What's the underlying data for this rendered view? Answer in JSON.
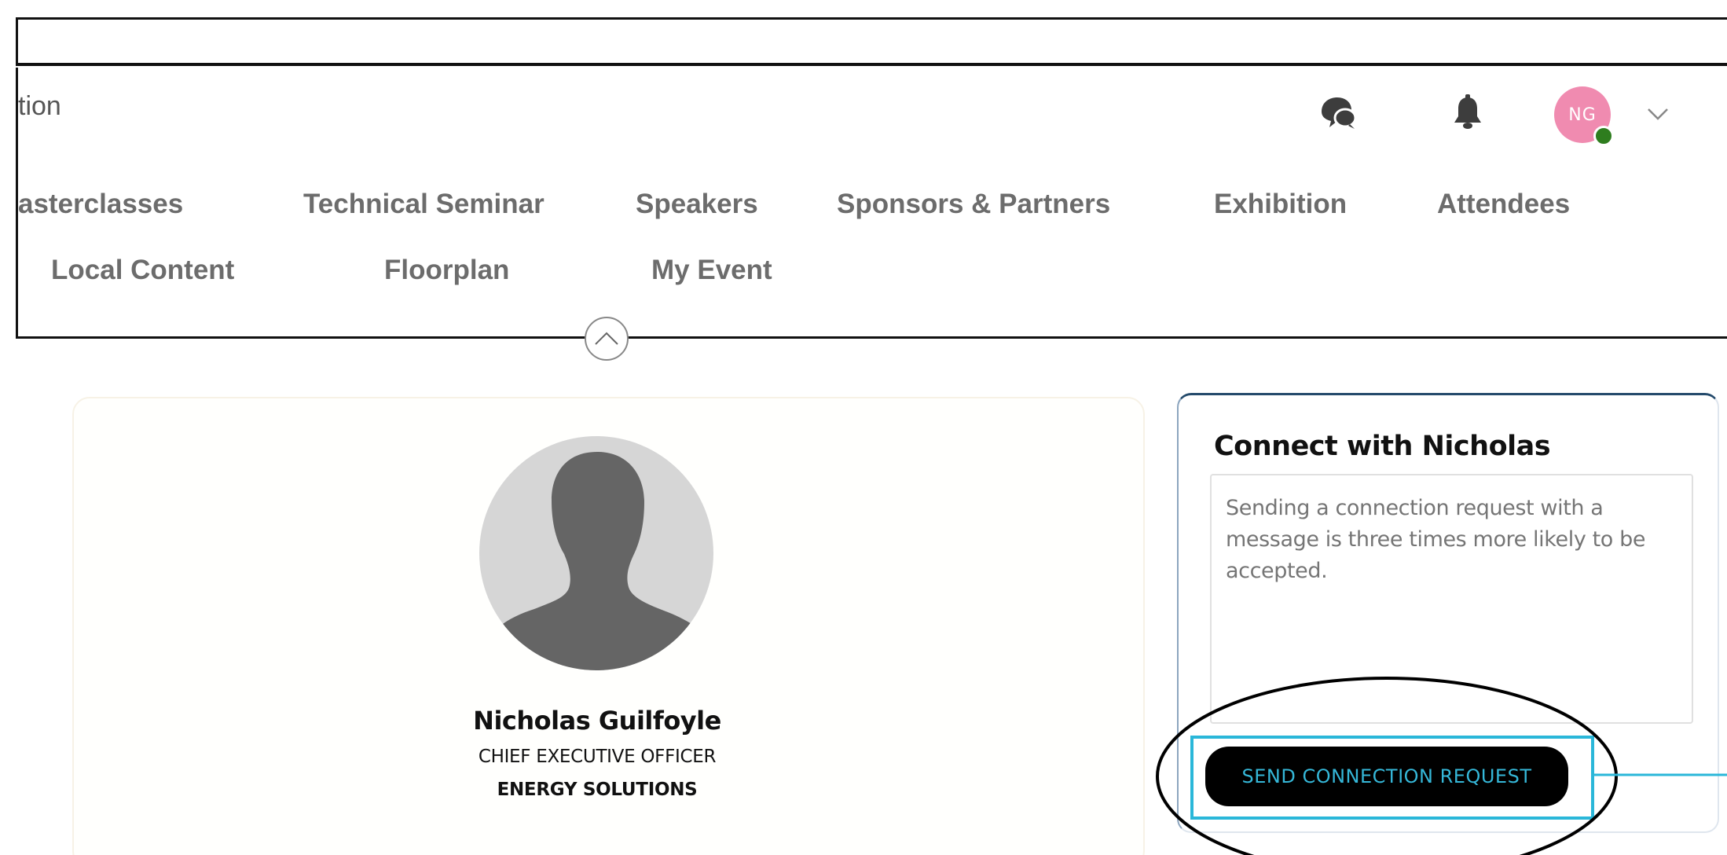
{
  "header": {
    "brand_fragment": "tion",
    "icons": [
      "chat-icon",
      "bell-icon",
      "chevron-down-icon"
    ],
    "user_initials": "NG",
    "status_color": "#2e7d1e",
    "avatar_color": "#f08bb0"
  },
  "nav": {
    "row1": [
      "asterclasses",
      "Technical Seminar",
      "Speakers",
      "Sponsors & Partners",
      "Exhibition",
      "Attendees"
    ],
    "row2": [
      "Local Content",
      "Floorplan",
      "My Event"
    ]
  },
  "profile": {
    "name": "Nicholas Guilfoyle",
    "role": "CHIEF EXECUTIVE OFFICER",
    "company": "ENERGY SOLUTIONS"
  },
  "connect": {
    "title": "Connect with Nicholas",
    "placeholder": "Sending a connection request with a message is three times more likely to be accepted.",
    "button_label": "SEND CONNECTION REQUEST",
    "button_text_color": "#35b7d8"
  },
  "annotation_color": "#2ab7d9"
}
